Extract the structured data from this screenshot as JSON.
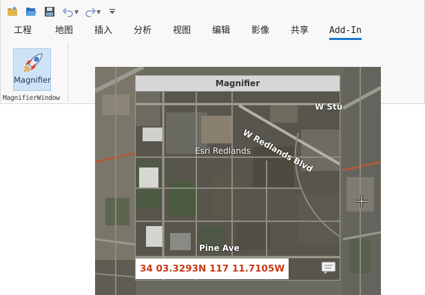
{
  "qat": {
    "icons": [
      "new-project-icon",
      "open-folder-icon",
      "save-icon",
      "undo-icon",
      "redo-icon",
      "customize-icon"
    ]
  },
  "tabs": [
    {
      "label": "工程"
    },
    {
      "label": "地图"
    },
    {
      "label": "插入"
    },
    {
      "label": "分析"
    },
    {
      "label": "视图"
    },
    {
      "label": "编辑"
    },
    {
      "label": "影像"
    },
    {
      "label": "共享"
    },
    {
      "label": "Add-In",
      "active": true
    }
  ],
  "group": {
    "button_label": "Magnifier",
    "label": "MagnifierWindow"
  },
  "magnifier": {
    "title": "Magnifier",
    "coordinates": "34 03.3293N 117 11.7105W"
  },
  "map_labels": {
    "street_w_redlands": "W Redlands Blvd",
    "street_w_stuart": "W Stu",
    "place_esri": "Esri Redlands",
    "street_pine": "Pine Ave"
  },
  "colors": {
    "accent": "#1a79d0",
    "coordinate_text": "#c83a16"
  }
}
